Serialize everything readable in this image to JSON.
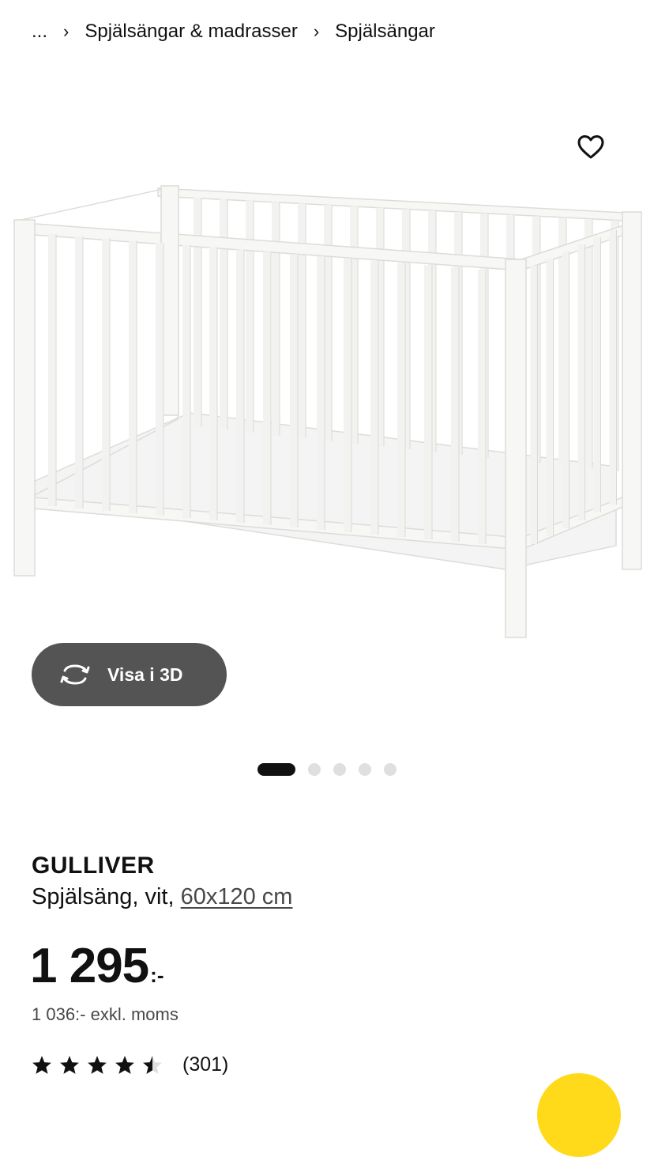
{
  "breadcrumb": {
    "ellipsis": "...",
    "items": [
      "Spjälsängar & madrasser",
      "Spjälsängar"
    ]
  },
  "gallery": {
    "favorite_icon": "heart-outline-icon",
    "view3d_icon": "rotate-3d-icon",
    "view3d_label": "Visa i 3D",
    "slides": 5,
    "active_slide": 1
  },
  "product": {
    "name": "GULLIVER",
    "description_prefix": "Spjälsäng, vit, ",
    "size_link": "60x120 cm",
    "price": "1 295",
    "price_suffix": ":-",
    "price_exvat": "1 036:- exkl. moms",
    "rating": 4.5,
    "review_count": "(301)"
  },
  "colors": {
    "accent_yellow": "#ffda1a",
    "button_dark": "#545454",
    "text": "#111111"
  }
}
